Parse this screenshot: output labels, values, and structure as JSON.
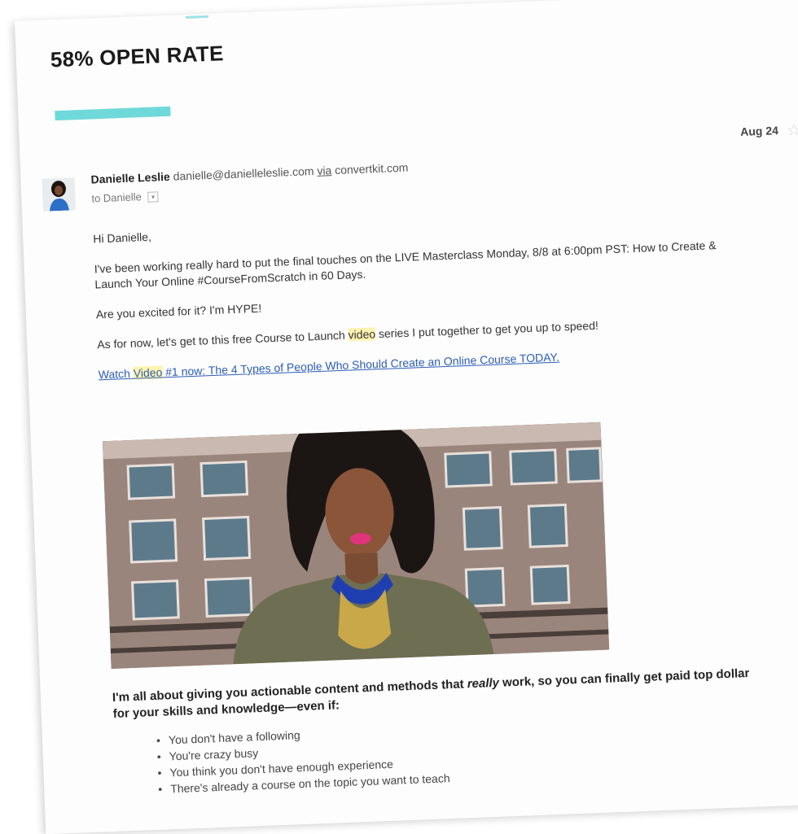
{
  "headline": "58% OPEN RATE",
  "email": {
    "sender_name": "Danielle Leslie",
    "sender_email": "danielle@danielleleslie.com",
    "via_word": "via",
    "via_domain": "convertkit.com",
    "to_label": "to Danielle",
    "date": "Aug 24",
    "greeting": "Hi Danielle,",
    "para1": "I've been working really hard to put the final touches on the LIVE Masterclass Monday, 8/8 at 6:00pm PST: How to Create & Launch Your Online #CourseFromScratch in 60 Days.",
    "para2": "Are you excited for it? I'm HYPE!",
    "para3_before": "As for now, let's get to this free Course to Launch ",
    "para3_highlight": "video",
    "para3_after": " series I put together to get you up to speed!",
    "link_before": "Watch ",
    "link_highlight": "Video",
    "link_after": " #1 now: The 4 Types of People Who Should Create an Online Course TODAY.",
    "closing_1": "I'm all about giving you actionable content and methods that ",
    "closing_em": "really",
    "closing_2": " work, so you can finally get paid top dollar for your skills and knowledge—even if:",
    "bullets": [
      "You don't have a following",
      "You're crazy busy",
      "You think you don't have enough experience",
      "There's already a course on the topic you want to teach"
    ]
  },
  "icons": {
    "star": "star-icon",
    "expand": "chevron-down-icon"
  },
  "colors": {
    "accent": "#6fd9da",
    "link": "#2c5db8",
    "highlight": "#fff3b0"
  }
}
